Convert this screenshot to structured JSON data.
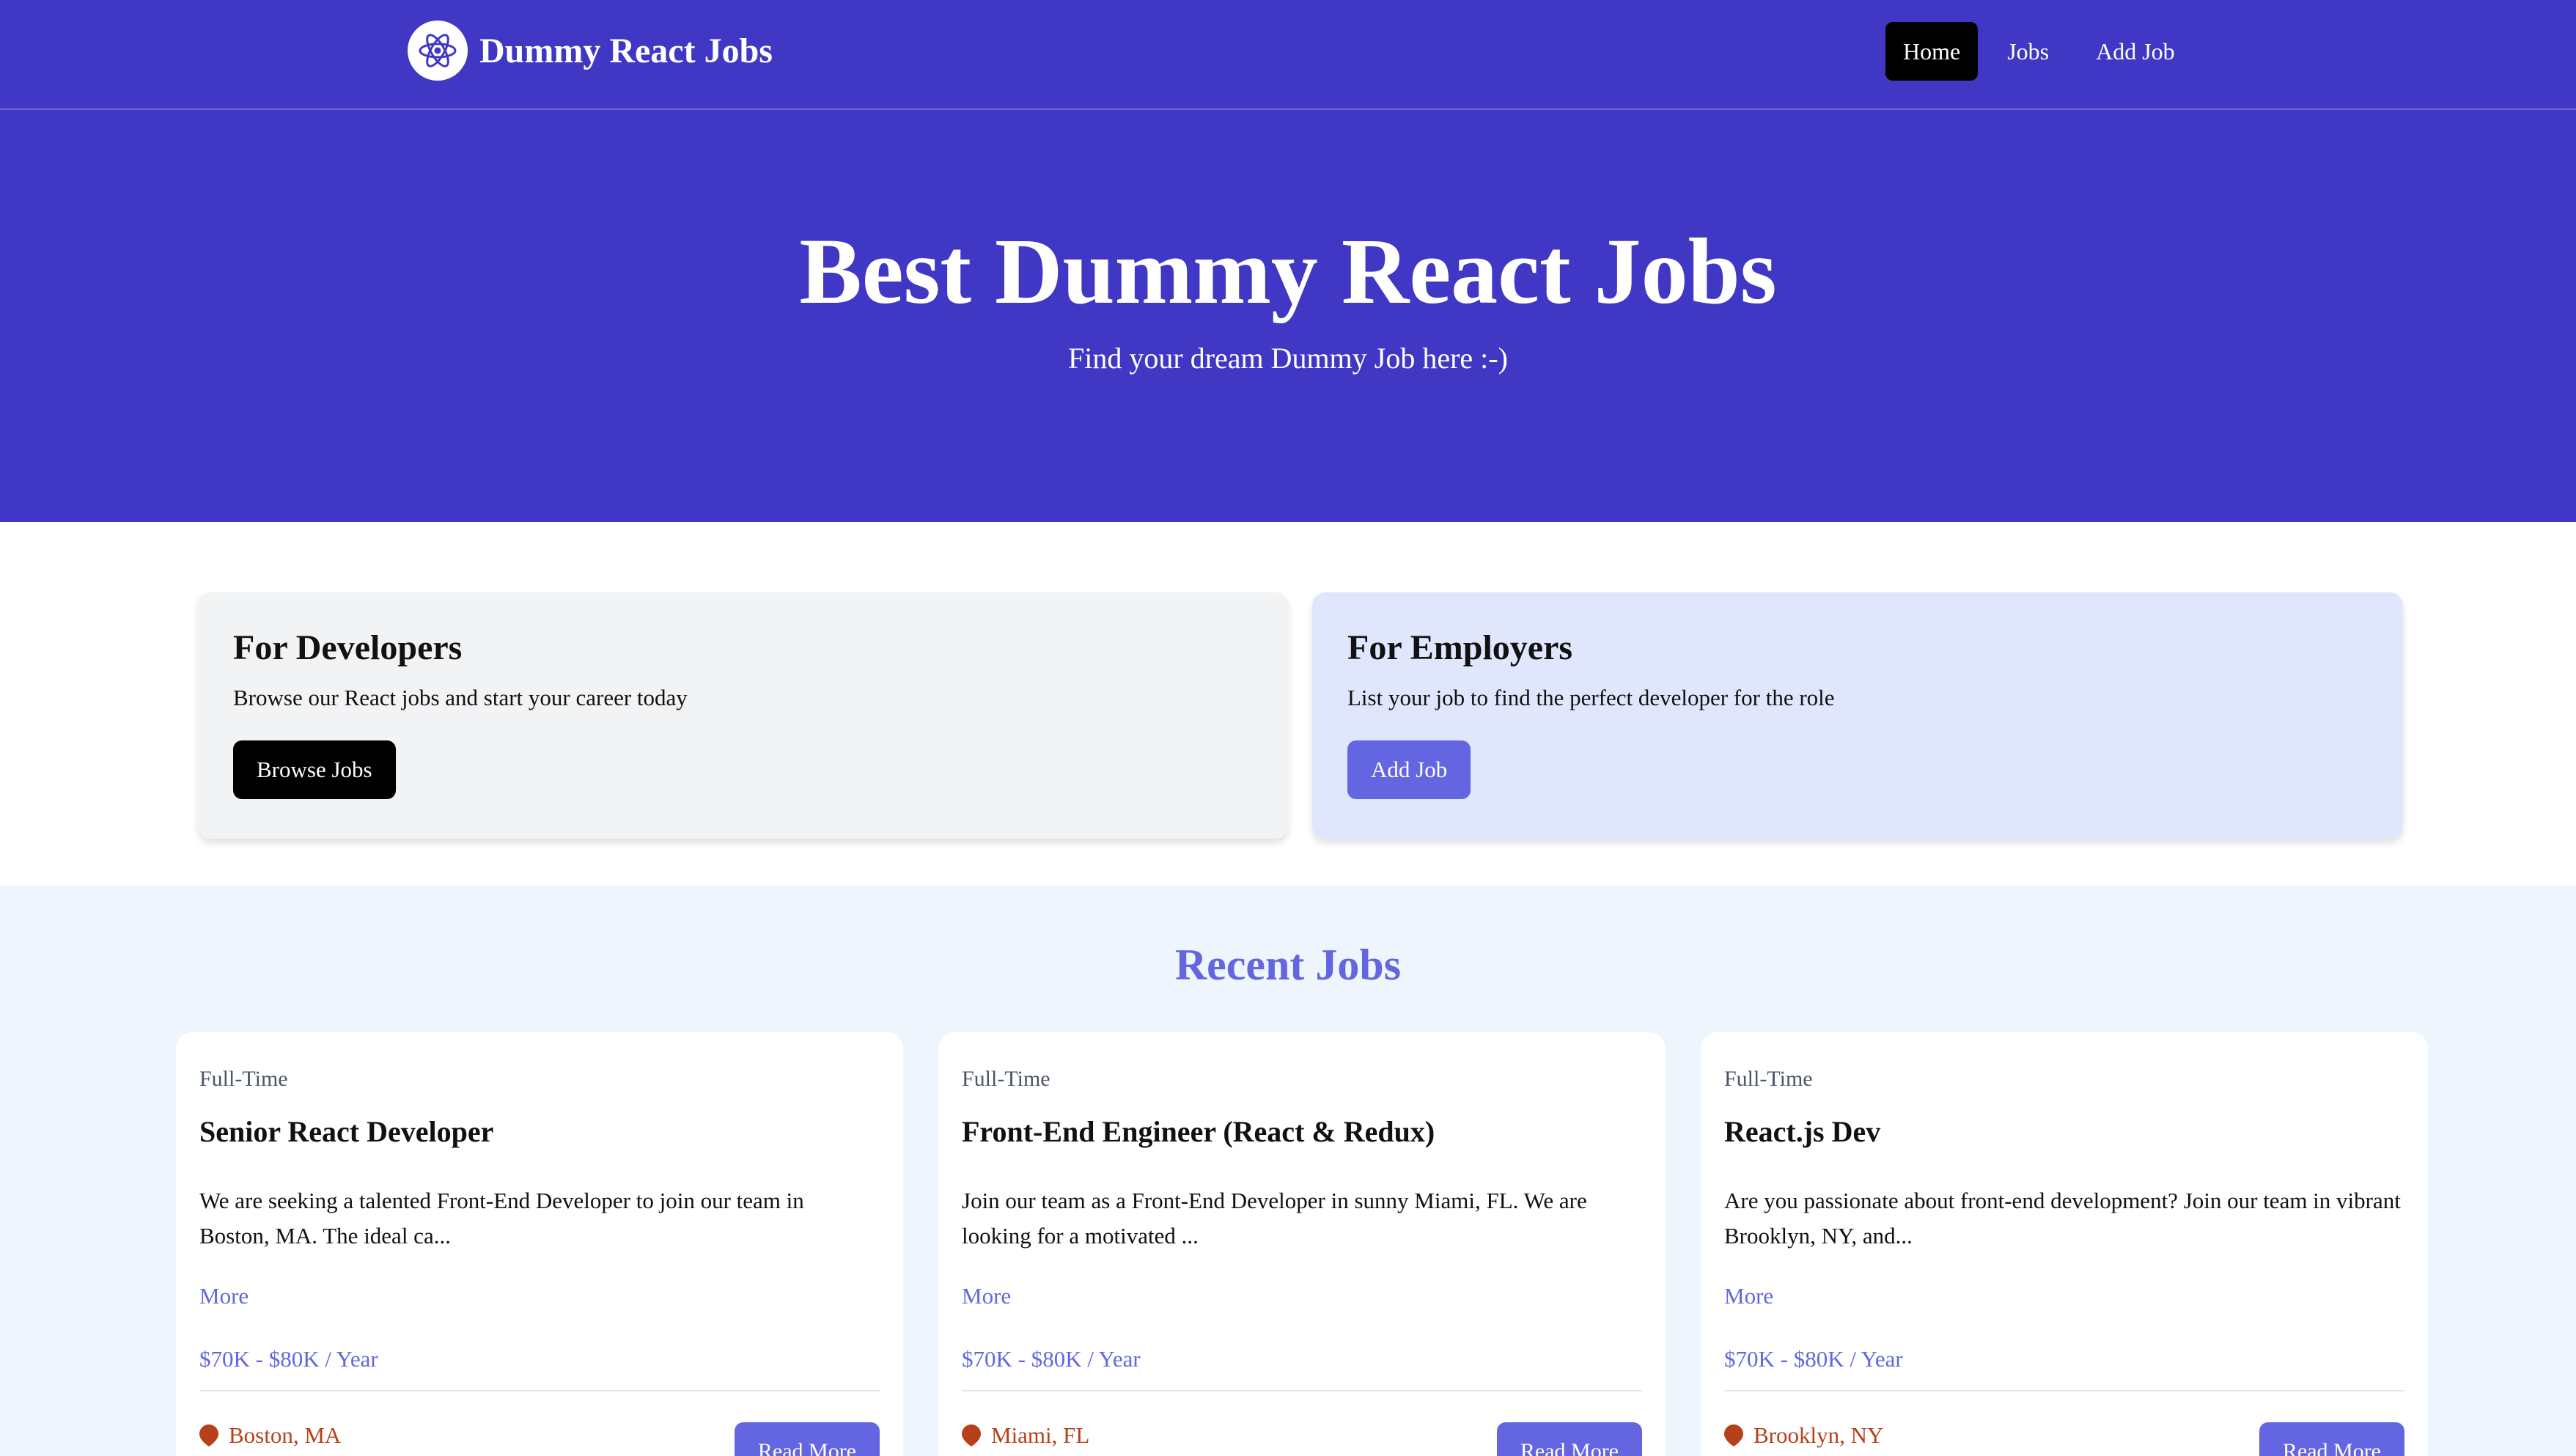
{
  "brand": {
    "name": "Dummy React Jobs",
    "icon": "react-atom-icon"
  },
  "nav": {
    "links": [
      {
        "label": "Home",
        "active": true
      },
      {
        "label": "Jobs",
        "active": false
      },
      {
        "label": "Add Job",
        "active": false
      }
    ]
  },
  "hero": {
    "title": "Best Dummy React Jobs",
    "subtitle": "Find your dream Dummy Job here :-)"
  },
  "info_cards": {
    "developers": {
      "title": "For Developers",
      "description": "Browse our React jobs and start your career today",
      "button_label": "Browse Jobs"
    },
    "employers": {
      "title": "For Employers",
      "description": "List your job to find the perfect developer for the role",
      "button_label": "Add Job"
    }
  },
  "recent_jobs": {
    "title": "Recent Jobs",
    "jobs": [
      {
        "type": "Full-Time",
        "title": "Senior React Developer",
        "description": "We are seeking a talented Front-End Developer to join our team in Boston, MA. The ideal ca...",
        "more_label": "More",
        "salary": "$70K - $80K / Year",
        "location": "Boston, MA",
        "button_label": "Read More"
      },
      {
        "type": "Full-Time",
        "title": "Front-End Engineer (React & Redux)",
        "description": "Join our team as a Front-End Developer in sunny Miami, FL. We are looking for a motivated ...",
        "more_label": "More",
        "salary": "$70K - $80K / Year",
        "location": "Miami, FL",
        "button_label": "Read More"
      },
      {
        "type": "Full-Time",
        "title": "React.js Dev",
        "description": "Are you passionate about front-end development? Join our team in vibrant Brooklyn, NY, and...",
        "more_label": "More",
        "salary": "$70K - $80K / Year",
        "location": "Brooklyn, NY",
        "button_label": "Read More"
      }
    ]
  },
  "colors": {
    "primary": "#4038c4",
    "accent": "#6366e0",
    "location": "#b5401a",
    "recent_bg": "#eef5fc",
    "employer_card_bg": "#e0e6fb",
    "developer_card_bg": "#f2f3f5"
  }
}
